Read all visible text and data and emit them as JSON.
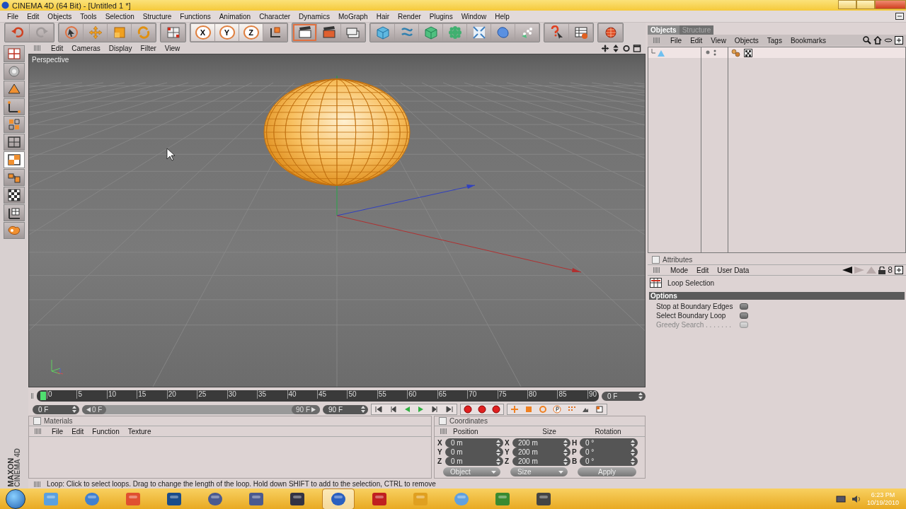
{
  "window": {
    "title": "CINEMA 4D (64 Bit) - [Untitled 1 *]"
  },
  "menu": [
    "File",
    "Edit",
    "Objects",
    "Tools",
    "Selection",
    "Structure",
    "Functions",
    "Animation",
    "Character",
    "Dynamics",
    "MoGraph",
    "Hair",
    "Render",
    "Plugins",
    "Window",
    "Help"
  ],
  "axis_buttons": [
    "X",
    "Y",
    "Z"
  ],
  "mode_tools": [
    {
      "selected": false
    },
    {
      "selected": false
    },
    {
      "selected": false
    },
    {
      "selected": false
    },
    {
      "selected": false
    },
    {
      "selected": false
    },
    {
      "selected": true
    },
    {
      "selected": false
    },
    {
      "selected": false
    },
    {
      "selected": false
    },
    {
      "selected": false
    }
  ],
  "branding": [
    "MAXON",
    "CINEMA 4D"
  ],
  "viewport": {
    "menu": [
      "Edit",
      "Cameras",
      "Display",
      "Filter",
      "View"
    ],
    "label": "Perspective"
  },
  "timeline": {
    "ticks": [
      "0",
      "5",
      "10",
      "15",
      "20",
      "25",
      "30",
      "35",
      "40",
      "45",
      "50",
      "55",
      "60",
      "65",
      "70",
      "75",
      "80",
      "85",
      "90"
    ],
    "current": "0 F",
    "start": "0 F",
    "range": {
      "start": "0 F",
      "end": "90 F",
      "level": 1
    },
    "end": "90 F"
  },
  "materials": {
    "title": "Materials",
    "checked": false,
    "menu": [
      "File",
      "Edit",
      "Function",
      "Texture"
    ]
  },
  "coordinates": {
    "title": "Coordinates",
    "checked": false,
    "headers": [
      "Position",
      "Size",
      "Rotation"
    ],
    "rows": [
      {
        "axes": [
          "X",
          "X",
          "H"
        ],
        "values": [
          "0 m",
          "200 m",
          "0 °"
        ]
      },
      {
        "axes": [
          "Y",
          "Y",
          "P"
        ],
        "values": [
          "0 m",
          "200 m",
          "0 °"
        ]
      },
      {
        "axes": [
          "Z",
          "Z",
          "B"
        ],
        "values": [
          "0 m",
          "200 m",
          "0 °"
        ]
      }
    ],
    "dropdowns": [
      "Object",
      "Size"
    ],
    "apply": "Apply"
  },
  "status": "Loop: Click to select loops. Drag to change the length of the loop. Hold down SHIFT to add to the selection, CTRL to remove",
  "objects": {
    "tabs": [
      {
        "label": "Objects",
        "selected": true
      },
      {
        "label": "Structure",
        "selected": false
      }
    ],
    "menu": [
      "File",
      "Edit",
      "View",
      "Objects",
      "Tags",
      "Bookmarks"
    ]
  },
  "attributes": {
    "title": "Attributes",
    "checked": false,
    "menu": [
      "Mode",
      "Edit",
      "User Data"
    ],
    "page_number": "8",
    "tool": "Loop Selection",
    "section": "Options",
    "options": [
      {
        "label": "Stop at Boundary Edges",
        "checked": false,
        "disabled": false
      },
      {
        "label": "Select Boundary Loop",
        "checked": false,
        "disabled": false
      },
      {
        "label": "Greedy Search . . . . . . .",
        "checked": false,
        "disabled": true
      }
    ]
  },
  "taskbar": {
    "apps": [
      {
        "selected": false
      },
      {
        "selected": false
      },
      {
        "selected": false
      },
      {
        "selected": false
      },
      {
        "selected": false
      },
      {
        "selected": false
      },
      {
        "selected": false
      },
      {
        "selected": true
      },
      {
        "selected": false
      },
      {
        "selected": false
      },
      {
        "selected": false
      },
      {
        "selected": false
      },
      {
        "selected": false
      }
    ],
    "time": "6:23 PM",
    "date": "10/19/2010"
  }
}
